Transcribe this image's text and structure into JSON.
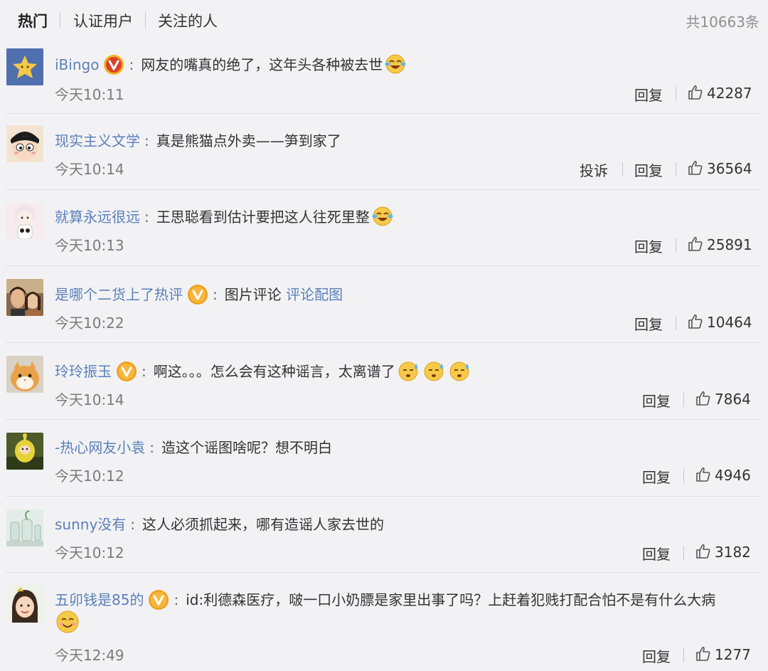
{
  "tabs": {
    "hot": "热门",
    "verified": "认证用户",
    "following": "关注的人"
  },
  "total": "共10663条",
  "actions": {
    "reply": "回复",
    "report": "投诉"
  },
  "colors": {
    "link": "#5b80b8",
    "badge": "#f0a01e",
    "badge_red": "#d9412a"
  },
  "comments": [
    {
      "user": "iBingo",
      "badge": "red-v",
      "text": "网友的嘴真的绝了，这年头各种被去世",
      "emoji": [
        "laugh-cry-emoji"
      ],
      "time": "今天10:11",
      "likes": "42287"
    },
    {
      "user": "现实主义文学",
      "badge": "",
      "text": "真是熊猫点外卖——笋到家了",
      "emoji": [],
      "time": "今天10:14",
      "likes": "36564",
      "report": true
    },
    {
      "user": "就算永远很远",
      "badge": "",
      "text": "王思聪看到估计要把这人往死里整",
      "emoji": [
        "laugh-cry-emoji"
      ],
      "time": "今天10:13",
      "likes": "25891"
    },
    {
      "user": "是哪个二货上了热评",
      "badge": "gold-v",
      "text": "图片评论",
      "link": "评论配图",
      "emoji": [],
      "time": "今天10:22",
      "likes": "10464"
    },
    {
      "user": "玲玲振玉",
      "badge": "gold-v",
      "text": "啊这。。。怎么会有这种谣言，太离谱了",
      "emoji": [
        "sweat-emoji",
        "sweat-emoji",
        "sweat-emoji"
      ],
      "time": "今天10:14",
      "likes": "7864"
    },
    {
      "user": "-热心网友小袁",
      "badge": "",
      "text": "造这个谣图啥呢？想不明白",
      "emoji": [],
      "time": "今天10:12",
      "likes": "4946"
    },
    {
      "user": "sunny没有",
      "badge": "",
      "text": "这人必须抓起来，哪有造谣人家去世的",
      "emoji": [],
      "time": "今天10:12",
      "likes": "3182"
    },
    {
      "user": "五卯钱是85的",
      "badge": "gold-v",
      "text": "id:利德森医疗，啵一口小奶膘是家里出事了吗？上赶着犯贱打配合怕不是有什么大病",
      "emoji": [
        "smile-emoji"
      ],
      "time": "今天12:49",
      "likes": "1277"
    }
  ]
}
